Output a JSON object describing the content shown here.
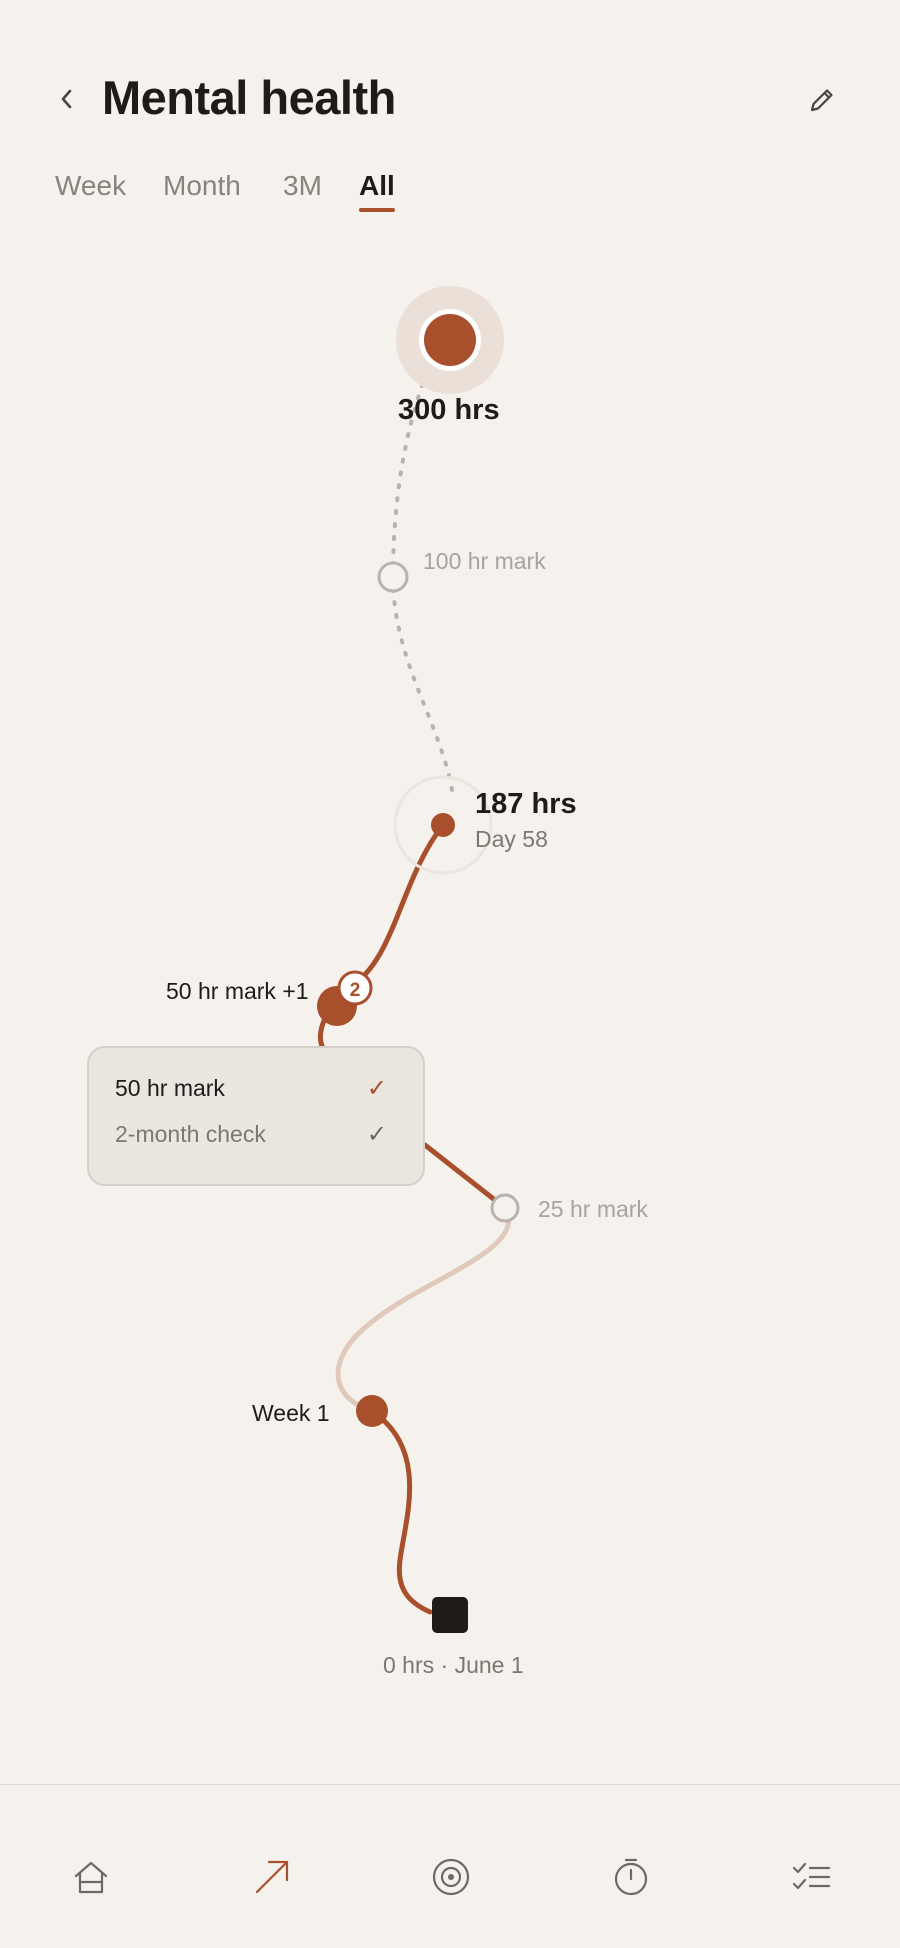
{
  "header": {
    "title": "Mental health"
  },
  "tabs": [
    {
      "label": "Week",
      "active": false
    },
    {
      "label": "Month",
      "active": false
    },
    {
      "label": "3M",
      "active": false
    },
    {
      "label": "All",
      "active": true
    }
  ],
  "journey": {
    "goal": {
      "label": "300 hrs"
    },
    "milestone_100": {
      "label": "100 hr mark"
    },
    "current": {
      "hours_label": "187 hrs",
      "day_label": "Day 58"
    },
    "milestone_50": {
      "label": "50 hr mark +1",
      "badge": "2"
    },
    "milestone_25": {
      "label": "25 hr mark"
    },
    "week1": {
      "label": "Week 1"
    },
    "start": {
      "label": "0 hrs · June 1"
    }
  },
  "popup": {
    "items": [
      {
        "label": "50 hr mark",
        "check": "✓"
      },
      {
        "label": "2-month check",
        "check": "✓"
      }
    ]
  },
  "colors": {
    "accent": "#a84f2c",
    "accent_light": "#e0c9bb",
    "background": "#f5f1ed",
    "muted": "#b9b3ae",
    "dark": "#1f1b18"
  },
  "nav": {
    "items": [
      {
        "icon": "home-icon",
        "active": false
      },
      {
        "icon": "trend-arrow-icon",
        "active": true
      },
      {
        "icon": "target-icon",
        "active": false
      },
      {
        "icon": "timer-icon",
        "active": false
      },
      {
        "icon": "checklist-icon",
        "active": false
      }
    ]
  }
}
